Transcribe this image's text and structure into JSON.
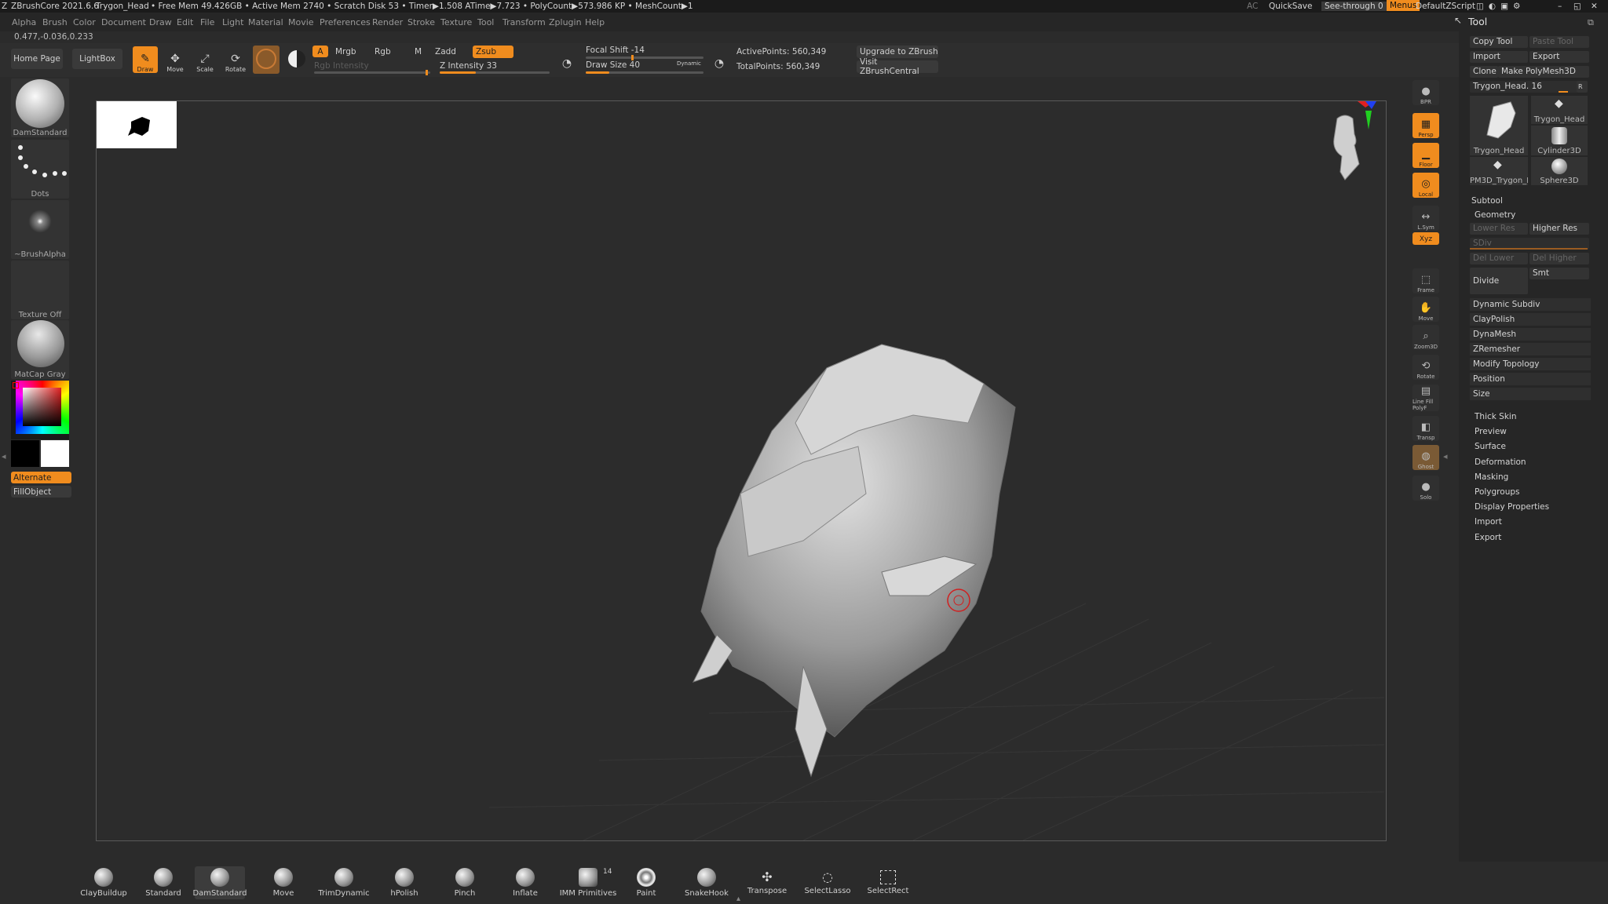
{
  "titlebar": {
    "app": "ZBrushCore 2021.6.6",
    "document": "Trygon_Head",
    "stats": "• Free Mem 49.426GB • Active Mem 2740 • Scratch Disk 53 •  Timer▶1.508 ATime▶7.723 • PolyCount▶573.986 KP  • MeshCount▶1",
    "ac": "AC",
    "quicksave": "QuickSave",
    "see_through": "See-through  0",
    "menus": "Menus",
    "zscript": "DefaultZScript"
  },
  "menu": [
    "Alpha",
    "Brush",
    "Color",
    "Document",
    "Draw",
    "Edit",
    "File",
    "Light",
    "Material",
    "Movie",
    "Preferences",
    "Render",
    "Stroke",
    "Texture",
    "Tool",
    "Transform",
    "Zplugin",
    "Help"
  ],
  "coords": "0.477,-0.036,0.233",
  "shelf": {
    "home_page": "Home Page",
    "lightbox": "LightBox",
    "draw": "Draw",
    "move": "Move",
    "scale": "Scale",
    "rotate": "Rotate",
    "a": "A",
    "mrgb": "Mrgb",
    "rgb": "Rgb",
    "m": "M",
    "zadd": "Zadd",
    "zsub": "Zsub",
    "rgb_intensity": "Rgb Intensity",
    "z_intensity": "Z Intensity 33",
    "z_intensity_value": 33,
    "focal_shift": "Focal Shift -14",
    "draw_size": "Draw Size 40",
    "dynamic": "Dynamic",
    "active_points": "ActivePoints: 560,349",
    "total_points": "TotalPoints: 560,349",
    "upgrade": "Upgrade to ZBrush",
    "visit": "Visit ZBrushCentral"
  },
  "left": {
    "brush": "DamStandard",
    "stroke": "Dots",
    "alpha": "~BrushAlpha",
    "texture": "Texture Off",
    "material": "MatCap Gray",
    "alternate": "Alternate",
    "fill": "FillObject"
  },
  "right_shelf": [
    "BPR",
    "Persp",
    "Floor",
    "Local",
    "L.Sym",
    "Xyz",
    "Frame",
    "Move",
    "Zoom3D",
    "Rotate",
    "Line Fill PolyF",
    "Transp",
    "Ghost",
    "Solo"
  ],
  "tool": {
    "title": "Tool",
    "copy": "Copy Tool",
    "paste": "Paste Tool",
    "import": "Import",
    "export": "Export",
    "clone": "Clone",
    "make_polymesh": "Make PolyMesh3D",
    "current": "Trygon_Head. 16",
    "r": "R",
    "thumbs": [
      "Trygon_Head",
      "Trygon_Head",
      "Cylinder3D",
      "PM3D_Trygon_H",
      "Sphere3D"
    ],
    "subtool": "Subtool",
    "geometry": "Geometry",
    "lower_res": "Lower Res",
    "higher_res": "Higher Res",
    "sdiv": "SDiv",
    "del_lower": "Del Lower",
    "del_higher": "Del Higher",
    "divide": "Divide",
    "smt": "Smt",
    "geo_items": [
      "Dynamic Subdiv",
      "ClayPolish",
      "DynaMesh",
      "ZRemesher",
      "Modify Topology",
      "Position",
      "Size"
    ],
    "sections": [
      "Thick Skin",
      "Preview",
      "Surface",
      "Deformation",
      "Masking",
      "Polygroups",
      "Display Properties",
      "Import",
      "Export"
    ]
  },
  "brushes": [
    "ClayBuildup",
    "Standard",
    "DamStandard",
    "Move",
    "TrimDynamic",
    "hPolish",
    "Pinch",
    "Inflate",
    "IMM Primitives",
    "Paint",
    "SnakeHook",
    "Transpose",
    "SelectLasso",
    "SelectRect"
  ],
  "imm_count": "14",
  "colors": {
    "accent": "#f08c1e",
    "bg": "#2b2b2b",
    "panel": "#262626"
  }
}
